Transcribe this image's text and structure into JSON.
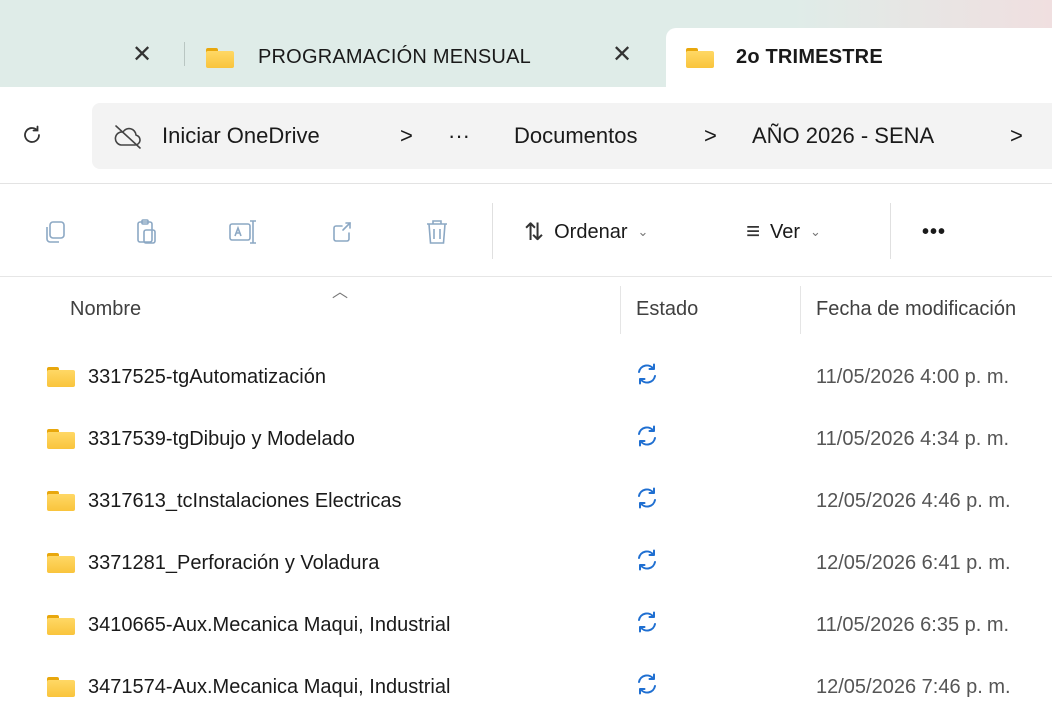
{
  "tabs": [
    {
      "label": "PROGRAMACIÓN MENSUAL",
      "active": false
    },
    {
      "label": "2o TRIMESTRE",
      "active": true
    }
  ],
  "address": {
    "crumbs": [
      "Iniciar OneDrive",
      "Documentos",
      "AÑO 2026 - SENA"
    ],
    "overflow": "···",
    "separator": ">"
  },
  "commands": {
    "sort_label": "Ordenar",
    "view_label": "Ver",
    "more_label": "•••",
    "icons": [
      "copy-icon",
      "paste-icon",
      "rename-icon",
      "share-icon",
      "delete-icon"
    ]
  },
  "columns": {
    "name": "Nombre",
    "status": "Estado",
    "modified": "Fecha de modificación"
  },
  "rows": [
    {
      "name": "3317525-tgAutomatización",
      "status": "sync-pending",
      "date": "11/05/2026 4:00 p. m."
    },
    {
      "name": "3317539-tgDibujo y Modelado",
      "status": "sync-pending",
      "date": "11/05/2026 4:34 p. m."
    },
    {
      "name": "3317613_tcInstalaciones Electricas",
      "status": "sync-pending",
      "date": "12/05/2026 4:46 p. m."
    },
    {
      "name": "3371281_Perforación y Voladura",
      "status": "sync-pending",
      "date": "12/05/2026 6:41 p. m."
    },
    {
      "name": "3410665-Aux.Mecanica Maqui, Industrial",
      "status": "sync-pending",
      "date": "11/05/2026 6:35 p. m."
    },
    {
      "name": "3471574-Aux.Mecanica Maqui, Industrial",
      "status": "sync-pending",
      "date": "12/05/2026 7:46 p. m."
    }
  ],
  "colors": {
    "folder": "#f9c43c",
    "sync": "#1f6fd1",
    "tab_strip": "#dfece8",
    "disabled_icon": "#8ca8c4"
  }
}
